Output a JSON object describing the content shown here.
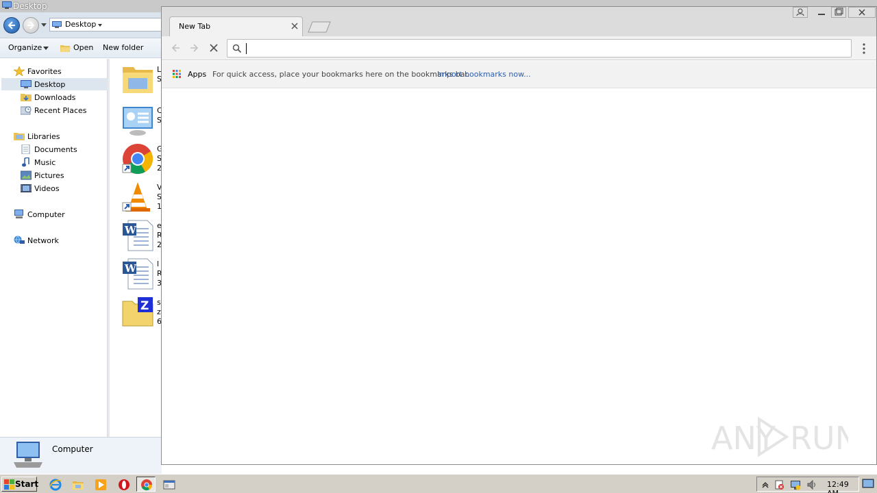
{
  "explorer": {
    "title": "Desktop",
    "address": "Desktop",
    "toolbar": {
      "organize": "Organize",
      "open": "Open",
      "new_folder": "New folder"
    },
    "nav": {
      "favorites": "Favorites",
      "desktop": "Desktop",
      "downloads": "Downloads",
      "recent_places": "Recent Places",
      "libraries": "Libraries",
      "documents": "Documents",
      "music": "Music",
      "pictures": "Pictures",
      "videos": "Videos",
      "computer": "Computer",
      "network": "Network"
    },
    "files": [
      {
        "icon": "folder-library-icon",
        "text": "L\nS"
      },
      {
        "icon": "control-panel-icon",
        "text": "C\nS"
      },
      {
        "icon": "chrome-shortcut-icon",
        "text": "G\nS\n2"
      },
      {
        "icon": "vlc-shortcut-icon",
        "text": "V\nS\n1"
      },
      {
        "icon": "word-doc-icon",
        "text": "e\nR\n2"
      },
      {
        "icon": "word-doc-icon",
        "text": "l\nR\n3"
      },
      {
        "icon": "zip-archive-icon",
        "text": "s\nz\n6"
      }
    ],
    "details": {
      "label": "Computer"
    }
  },
  "chrome": {
    "tab_title": "New Tab",
    "omnibox": {
      "value": "",
      "placeholder": ""
    },
    "bookmarks": {
      "apps": "Apps",
      "hint": "For quick access, place your bookmarks here on the bookmarks bar.",
      "import": "Import bookmarks now..."
    },
    "colors": {
      "link": "#2a5db0"
    }
  },
  "watermark": {
    "text": "ANY RUN"
  },
  "taskbar": {
    "start": "Start",
    "clock": "12:49 AM"
  }
}
